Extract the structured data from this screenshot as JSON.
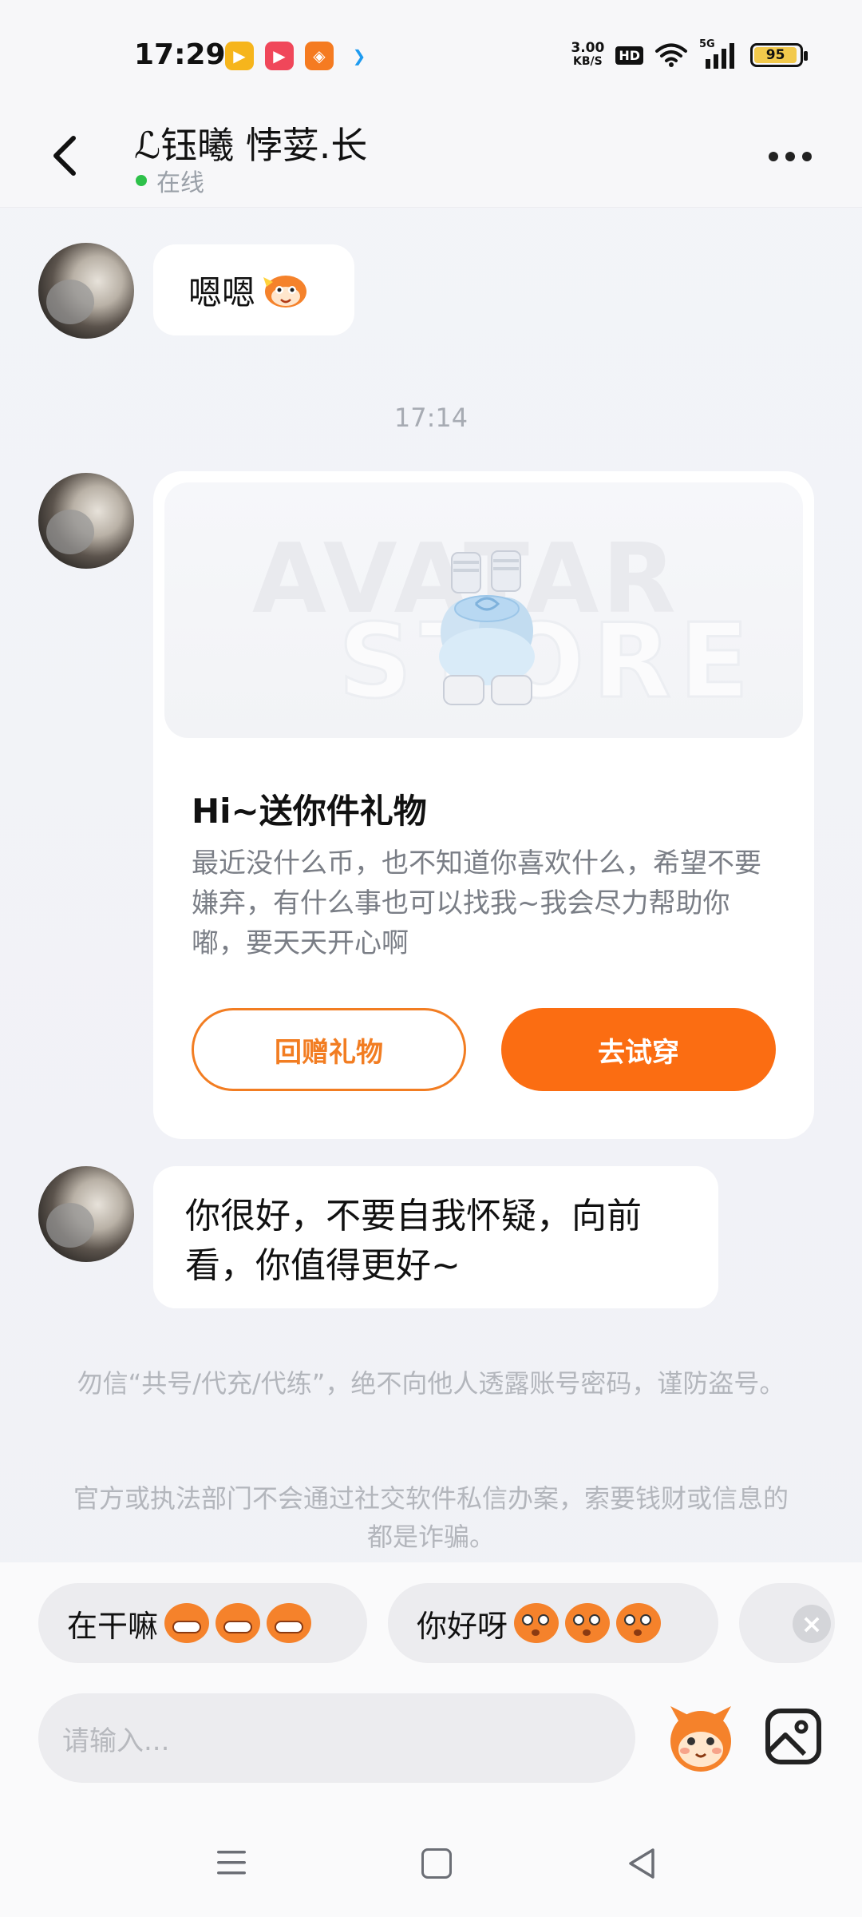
{
  "status_bar": {
    "time": "17:29",
    "apps": [
      "app-icon-1",
      "app-icon-2",
      "app-icon-3",
      "app-icon-4"
    ],
    "net_speed_value": "3.00",
    "net_speed_unit": "KB/S",
    "hd": "HD",
    "signal_label": "5G",
    "battery": "95",
    "battery_level": 0.95
  },
  "header": {
    "contact_name": "ℒ钰曦 悖荽.长",
    "status": "在线",
    "status_color": "#2ec14a"
  },
  "messages": [
    {
      "text": "嗯嗯"
    },
    {
      "time": "17:14"
    },
    {
      "card": {
        "title": "Hi~送你件礼物",
        "body": "最近没什么币，也不知道你喜欢什么，希望不要嫌弃，有什么事也可以找我~我会尽力帮助你嘟，要天天开心啊",
        "image_watermark_1": "AVATAR",
        "image_watermark_2": "STORE",
        "btn_return": "回赠礼物",
        "btn_try": "去试穿"
      }
    },
    {
      "text": "你很好，不要自我怀疑，向前看，你值得更好~"
    }
  ],
  "notices": {
    "notice1": "勿信“共号/代充/代练”，绝不向他人透露账号密码，谨防盗号。",
    "notice2": "官方或执法部门不会通过社交软件私信办案，索要钱财或信息的都是诈骗。"
  },
  "quick_replies": {
    "chip1": "在干嘛",
    "chip2": "你好呀"
  },
  "composer": {
    "placeholder": "请输入..."
  },
  "colors": {
    "accent": "#fb6d12",
    "accent_outline": "#f27d22"
  }
}
